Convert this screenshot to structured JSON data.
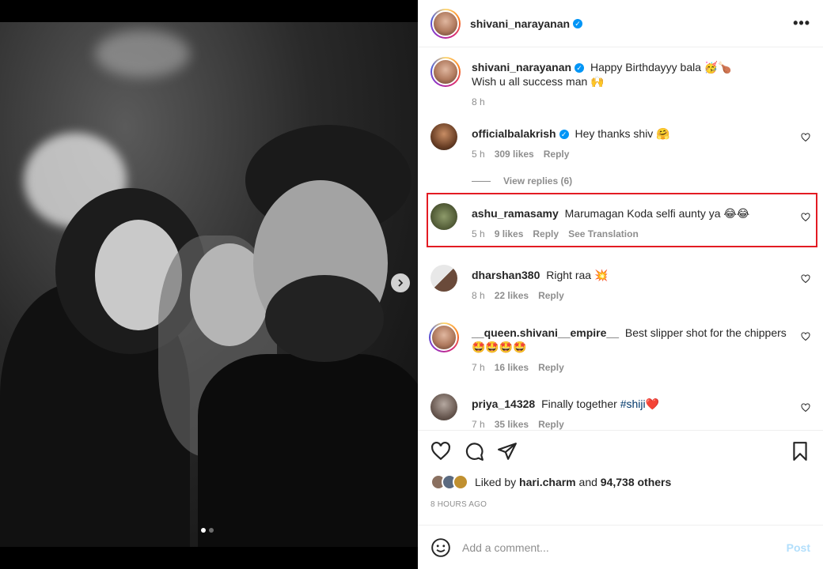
{
  "post": {
    "username": "shivani_narayanan",
    "more_label": "•••"
  },
  "caption": {
    "username": "shivani_narayanan",
    "text_line1": "Happy Birthdayyy bala 🥳🍗",
    "text_line2": "Wish u all success man 🙌",
    "time": "8 h"
  },
  "comments": [
    {
      "username": "officialbalakrish",
      "verified": true,
      "text": "Hey thanks shiv 🤗",
      "time": "5 h",
      "likes": "309 likes",
      "reply": "Reply"
    },
    {
      "username": "ashu_ramasamy",
      "text": "Marumagan Koda selfi aunty ya 😂😂",
      "time": "5 h",
      "likes": "9 likes",
      "reply": "Reply",
      "translate": "See Translation"
    },
    {
      "username": "dharshan380",
      "text": "Right raa 💥",
      "time": "8 h",
      "likes": "22 likes",
      "reply": "Reply"
    },
    {
      "username": "__queen.shivani__empire__",
      "text": "Best slipper shot for the chippers",
      "text2": "🤩🤩🤩🤩",
      "time": "7 h",
      "likes": "16 likes",
      "reply": "Reply"
    },
    {
      "username": "priya_14328",
      "text": "Finally together",
      "hashtag": "#shiji",
      "emoji": "❤️",
      "time": "7 h",
      "likes": "35 likes",
      "reply": "Reply"
    }
  ],
  "view_replies": "View replies (6)",
  "likes": {
    "prefix": "Liked by",
    "user": "hari.charm",
    "middle": "and",
    "others": "94,738 others"
  },
  "time_ago": "8 HOURS AGO",
  "add_comment": {
    "placeholder": "Add a comment...",
    "post_label": "Post"
  },
  "colors": {
    "verified": "#0095f6",
    "highlight_border": "#e31b23",
    "post_button_disabled": "#b2dffc"
  }
}
